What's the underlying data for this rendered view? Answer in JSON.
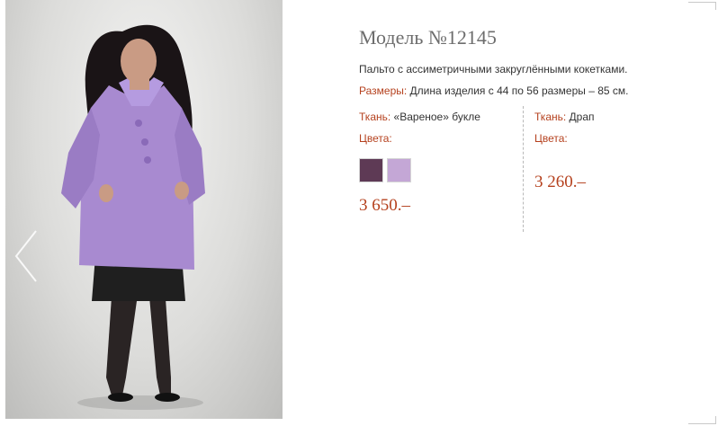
{
  "product": {
    "title": "Модель №12145",
    "description": "Пальто с ассиметричными  закруглёнными кокетками.",
    "sizes_label": "Размеры:",
    "sizes_value": " Длина изделия с 44 по 56 размеры – 85 см."
  },
  "variants": [
    {
      "fabric_label": "Ткань:",
      "fabric_value": " «Вареное» букле",
      "colors_label": "Цвета:",
      "swatch_colors": [
        "#5e3a55",
        "#c4a7d6"
      ],
      "price": "3 650.–"
    },
    {
      "fabric_label": "Ткань:",
      "fabric_value": " Драп",
      "colors_label": "Цвета:",
      "swatch_colors": [],
      "price": "3 260.–"
    }
  ],
  "photo": {
    "background": "#d8d8d6",
    "coat_color": "#a88ad0",
    "skirt_color": "#1f1f1f",
    "hair_color": "#1a1416",
    "skin_color": "#c99b84"
  },
  "nav": {
    "prev_icon": "chevron-left-icon"
  }
}
